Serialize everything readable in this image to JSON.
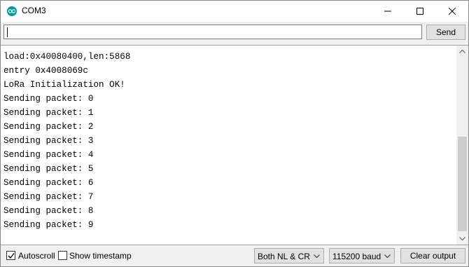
{
  "window": {
    "title": "COM3",
    "icon": "arduino-logo-icon",
    "controls": [
      "minimize-icon",
      "maximize-icon",
      "close-icon"
    ]
  },
  "send_bar": {
    "input_value": "",
    "send_label": "Send"
  },
  "output": {
    "lines": [
      "load:0x40080400,len:5868",
      "entry 0x4008069c",
      "LoRa Initialization OK!",
      "Sending packet: 0",
      "Sending packet: 1",
      "Sending packet: 2",
      "Sending packet: 3",
      "Sending packet: 4",
      "Sending packet: 5",
      "Sending packet: 6",
      "Sending packet: 7",
      "Sending packet: 8",
      "Sending packet: 9"
    ]
  },
  "footer": {
    "autoscroll_label": "Autoscroll",
    "autoscroll_checked": true,
    "timestamp_label": "Show timestamp",
    "timestamp_checked": false,
    "line_ending": "Both NL & CR",
    "baud_rate": "115200 baud",
    "clear_label": "Clear output"
  },
  "colors": {
    "accent": "#00979c"
  }
}
